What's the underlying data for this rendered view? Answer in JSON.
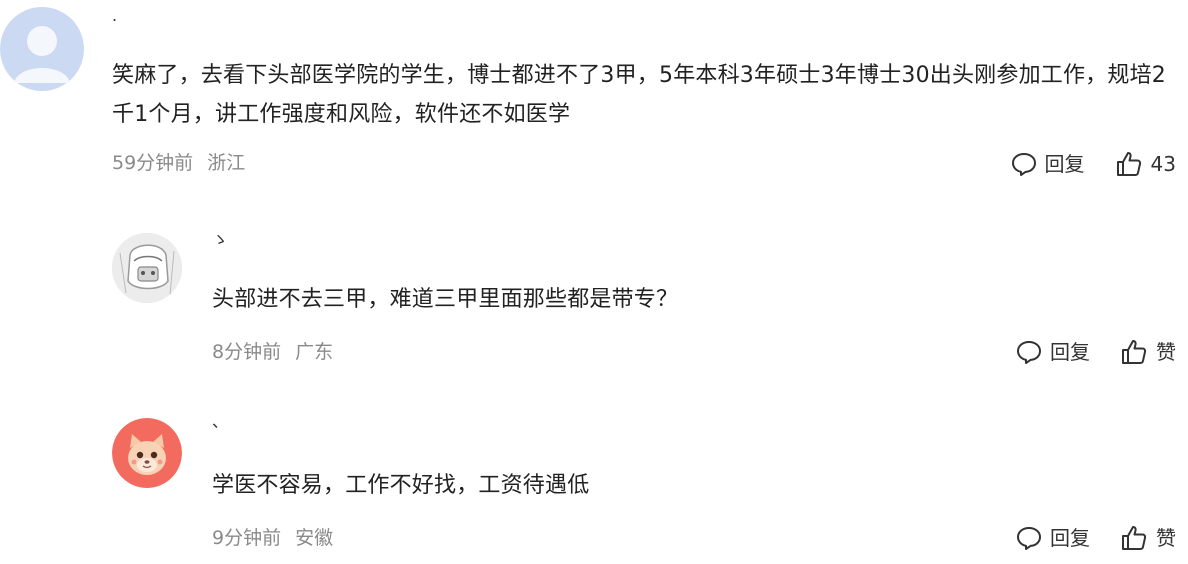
{
  "comments": [
    {
      "username": ".",
      "text": "笑麻了，去看下头部医学院的学生，博士都进不了3甲，5年本科3年硕士3年博士30出头刚参加工作，规培2千1个月，讲工作强度和风险，软件还不如医学",
      "time": "59分钟前",
      "location": "浙江",
      "reply_label": "回复",
      "like_label": "43",
      "avatar_icon": "default-user-avatar"
    },
    {
      "username": "ゝ",
      "text": "头部进不去三甲，难道三甲里面那些都是带专？",
      "time": "8分钟前",
      "location": "广东",
      "reply_label": "回复",
      "like_label": "赞",
      "avatar_icon": "sketch-character-avatar"
    },
    {
      "username": "、",
      "text": "学医不容易，工作不好找，工资待遇低",
      "time": "9分钟前",
      "location": "安徽",
      "reply_label": "回复",
      "like_label": "赞",
      "avatar_icon": "cartoon-cat-avatar"
    }
  ],
  "colors": {
    "text": "#222222",
    "meta": "#8a8a8a",
    "avatar_default": "#c7d6f0"
  }
}
